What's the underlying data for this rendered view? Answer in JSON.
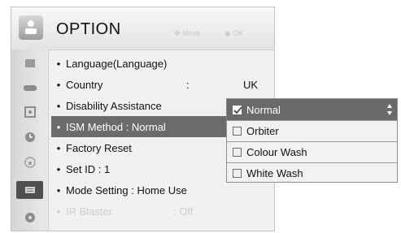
{
  "header": {
    "title": "OPTION",
    "hint_move": "Move",
    "hint_ok": "OK"
  },
  "sidebar": {
    "items": [
      {
        "icon": "picture-icon"
      },
      {
        "icon": "audio-icon"
      },
      {
        "icon": "setup-icon"
      },
      {
        "icon": "time-icon"
      },
      {
        "icon": "lock-icon"
      },
      {
        "icon": "option-icon",
        "active": true
      },
      {
        "icon": "network-icon"
      }
    ]
  },
  "menu": {
    "items": [
      {
        "label": "Language(Language)",
        "value": ""
      },
      {
        "label": "Country",
        "colon": ":",
        "value": "UK"
      },
      {
        "label": "Disability Assistance",
        "value": ""
      },
      {
        "label": "ISM Method  : Normal",
        "value": "",
        "selected": true
      },
      {
        "label": "Factory Reset",
        "value": ""
      },
      {
        "label": "Set ID  : 1",
        "value": ""
      },
      {
        "label": "Mode Setting  : Home Use",
        "value": ""
      },
      {
        "label": "IR Blaster",
        "value": ": Off",
        "disabled": true
      }
    ]
  },
  "popup": {
    "options": [
      {
        "label": "Normal",
        "checked": true
      },
      {
        "label": "Orbiter",
        "checked": false
      },
      {
        "label": "Colour Wash",
        "checked": false
      },
      {
        "label": "White Wash",
        "checked": false
      }
    ]
  },
  "colors": {
    "selected_bg": "#6b6b6b",
    "active_sidebar": "#4f4f4f",
    "popup_head": "#6a6a6a"
  }
}
